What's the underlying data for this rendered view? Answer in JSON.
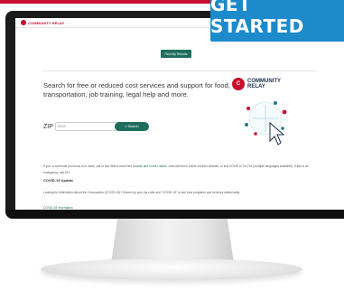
{
  "banner": {
    "label": "GET STARTED"
  },
  "site": {
    "logo_text": "COMMUNITY RELAY",
    "logo_tag": "·······",
    "find_results_label": "Find My Results",
    "headline": "Search for free or reduced cost services and support for food, transportation, job training, legal help and more.",
    "zip": {
      "label": "ZIP",
      "placeholder": "85001"
    },
    "search_label": "Search",
    "illustration": {
      "brand_line1": "COMMUNITY",
      "brand_line2": "RELAY",
      "badge": "C"
    },
    "crisis": {
      "before": "If you or someone you know is in crisis, call or text 988 to reach the ",
      "link": "Suicide and Crisis Lifeline",
      "after": ", chat with them online via their website, or text HOME to 741741 (multiple languages available). If this is an emergency, call 911."
    },
    "covid": {
      "title": "COVID-19 Update",
      "text": "Looking for information about the Coronavirus (COVID-19)? Search by your zip code and \"COVID-19\" to see new programs and services added daily.",
      "link": "COVID-19 Information"
    }
  },
  "colors": {
    "brand_red": "#c8102e",
    "brand_green": "#1f6e5d",
    "banner_blue": "#1d8acb"
  }
}
